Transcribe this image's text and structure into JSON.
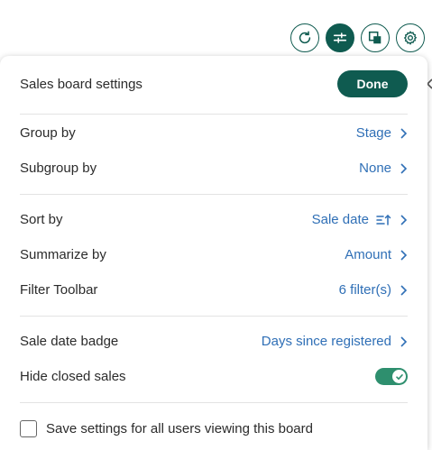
{
  "toolbar": {
    "buttons": [
      {
        "icon": "refresh-icon",
        "active": false
      },
      {
        "icon": "sliders-icon",
        "active": true
      },
      {
        "icon": "layers-icon",
        "active": false
      },
      {
        "icon": "gear-icon",
        "active": false
      }
    ]
  },
  "panel": {
    "title": "Sales board settings",
    "done_label": "Done",
    "rows": {
      "group_by": {
        "label": "Group by",
        "value": "Stage"
      },
      "subgroup_by": {
        "label": "Subgroup by",
        "value": "None"
      },
      "sort_by": {
        "label": "Sort by",
        "value": "Sale date",
        "direction": "ascending"
      },
      "summarize_by": {
        "label": "Summarize by",
        "value": "Amount"
      },
      "filter_toolbar": {
        "label": "Filter Toolbar",
        "value": "6 filter(s)"
      },
      "sale_date_badge": {
        "label": "Sale date badge",
        "value": "Days since registered"
      },
      "hide_closed_sales": {
        "label": "Hide closed sales",
        "enabled": true
      }
    },
    "save_for_all": {
      "label": "Save settings for all users viewing this board",
      "checked": false
    }
  },
  "colors": {
    "accent": "#0f5b50",
    "link": "#2f6fb6",
    "toggle_on": "#2e8f6e"
  }
}
